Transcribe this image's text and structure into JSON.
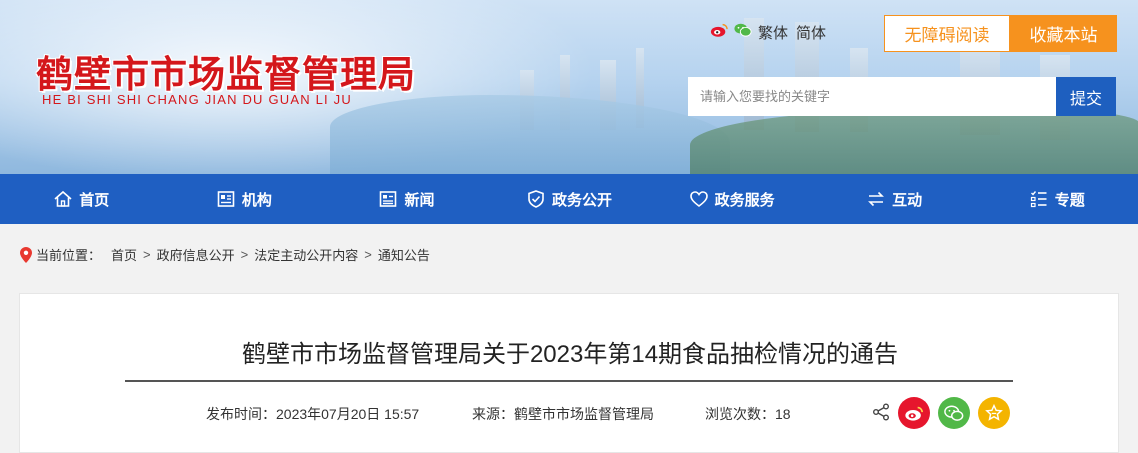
{
  "header": {
    "title_cn": "鹤壁市市场监督管理局",
    "title_en": "HE BI SHI SHI CHANG JIAN DU GUAN LI JU",
    "lang_traditional": "繁体",
    "lang_simplified": "简体",
    "accessibility_label": "无障碍阅读",
    "favorite_label": "收藏本站",
    "search_placeholder": "请输入您要找的关键字",
    "search_button": "提交"
  },
  "nav": {
    "items": [
      {
        "label": "首页",
        "icon": "home-icon"
      },
      {
        "label": "机构",
        "icon": "organization-icon"
      },
      {
        "label": "新闻",
        "icon": "news-icon"
      },
      {
        "label": "政务公开",
        "icon": "shield-icon"
      },
      {
        "label": "政务服务",
        "icon": "heart-icon"
      },
      {
        "label": "互动",
        "icon": "exchange-icon"
      },
      {
        "label": "专题",
        "icon": "list-icon"
      }
    ]
  },
  "breadcrumb": {
    "label": "当前位置：",
    "items": [
      "首页",
      "政府信息公开",
      "法定主动公开内容",
      "通知公告"
    ],
    "separator": ">"
  },
  "article": {
    "title": "鹤壁市市场监督管理局关于2023年第14期食品抽检情况的通告",
    "publish_time": "发布时间：2023年07月20日 15:57",
    "source": "来源：鹤壁市市场监督管理局",
    "views": "浏览次数：18"
  },
  "colors": {
    "brand_red": "#d4171b",
    "nav_blue": "#1f5fc2",
    "accent_orange": "#f6921e",
    "weibo_red": "#e6162d",
    "wechat_green": "#51b848",
    "fav_yellow": "#f4b400"
  }
}
